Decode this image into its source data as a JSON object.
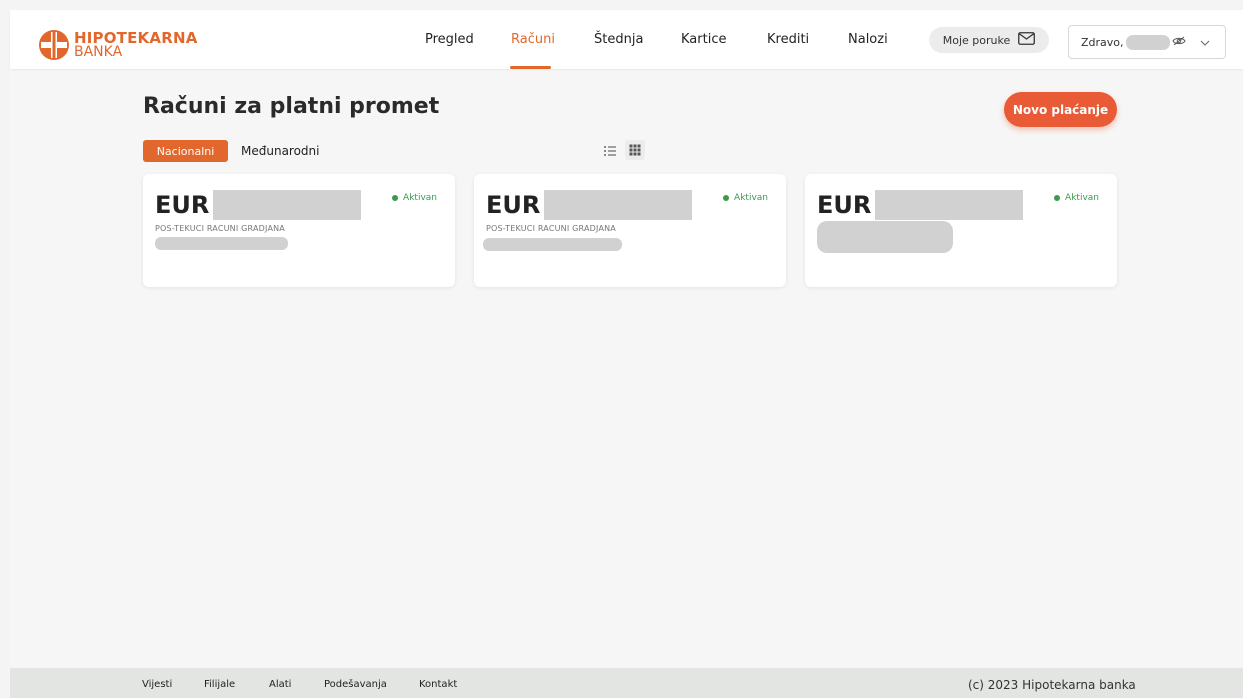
{
  "brand": {
    "line1": "HIPOTEKARNA",
    "line2": "BANKA",
    "color": "#e2672c"
  },
  "nav": {
    "items": [
      {
        "label": "Pregled",
        "active": false
      },
      {
        "label": "Računi",
        "active": true
      },
      {
        "label": "Štednja",
        "active": false
      },
      {
        "label": "Kartice",
        "active": false
      },
      {
        "label": "Krediti",
        "active": false
      },
      {
        "label": "Nalozi",
        "active": false
      }
    ],
    "messages_label": "Moje poruke",
    "messages_icon": "envelope-icon",
    "user_greeting": "Zdravo,",
    "visibility_icon": "eye-slash-icon",
    "dropdown_icon": "chevron-down-icon"
  },
  "main": {
    "title": "Računi za platni promet",
    "new_payment_label": "Novo plaćanje",
    "tabs": [
      {
        "label": "Nacionalni",
        "active": true
      },
      {
        "label": "Međunarodni",
        "active": false
      }
    ],
    "view_icons": [
      "list-view-icon",
      "grid-view-icon"
    ],
    "accounts": [
      {
        "currency": "EUR",
        "status": "Aktivan",
        "type": "POS-TEKUCI RACUNI GRADJANA"
      },
      {
        "currency": "EUR",
        "status": "Aktivan",
        "type": "POS-TEKUCI RACUNI GRADJANA"
      },
      {
        "currency": "EUR",
        "status": "Aktivan",
        "type": ""
      }
    ]
  },
  "footer": {
    "links": [
      "Vijesti",
      "Filijale",
      "Alati",
      "Podešavanja",
      "Kontakt"
    ],
    "copyright": "(c) 2023 Hipotekarna banka"
  },
  "colors": {
    "accent": "#e2672c",
    "cta": "#e85b36",
    "active_status": "#3a9b4f"
  }
}
